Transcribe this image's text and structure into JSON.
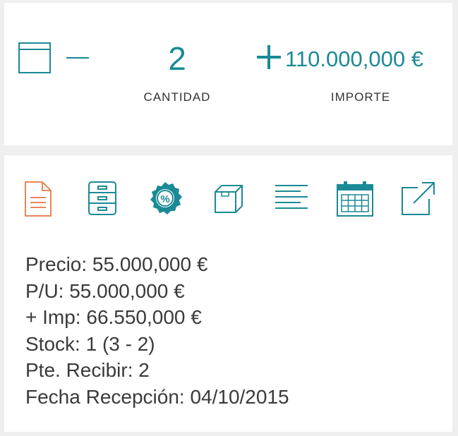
{
  "summary": {
    "quantity_value": "2",
    "quantity_label": "CANTIDAD",
    "amount_value": "110.000,000 €",
    "amount_label": "IMPORTE"
  },
  "actions": {
    "icons": [
      "document-icon",
      "filing-cabinet-icon",
      "discount-badge-icon",
      "box-icon",
      "text-lines-icon",
      "calendar-icon",
      "external-link-icon"
    ]
  },
  "details": {
    "precio": "Precio: 55.000,000 €",
    "pu": "P/U: 55.000,000 €",
    "imp": "+ Imp: 66.550,000 €",
    "stock": "Stock: 1 (3 - 2)",
    "pte_recibir": "Pte. Recibir: 2",
    "fecha_recepcion": "Fecha Recepción: 04/10/2015"
  },
  "colors": {
    "accent": "#1a8a96",
    "document_icon": "#e8875a",
    "text": "#3a3a3a",
    "background": "#efefef",
    "card": "#ffffff"
  }
}
